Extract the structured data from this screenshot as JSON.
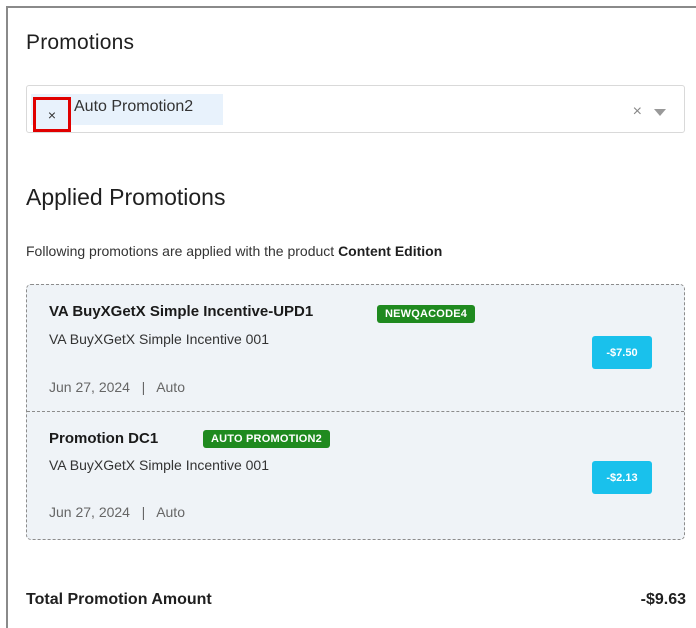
{
  "promotions": {
    "title": "Promotions",
    "selected_tag": "Auto Promotion2",
    "tag_remove_glyph": "×",
    "clear_glyph": "×"
  },
  "applied": {
    "title": "Applied Promotions",
    "description_prefix": "Following promotions are applied with the product",
    "product_name": "Content Edition",
    "items": [
      {
        "name": "VA BuyXGetX Simple Incentive-UPD1",
        "code": "NEWQACODE4",
        "description": "VA BuyXGetX Simple Incentive 001",
        "date": "Jun 27, 2024",
        "separator": "|",
        "type": "Auto",
        "amount": "-$7.50"
      },
      {
        "name": "Promotion DC1",
        "code": "AUTO PROMOTION2",
        "description": "VA BuyXGetX Simple Incentive 001",
        "date": "Jun 27, 2024",
        "separator": "|",
        "type": "Auto",
        "amount": "-$2.13"
      }
    ]
  },
  "total": {
    "label": "Total Promotion Amount",
    "value": "-$9.63"
  },
  "colors": {
    "code_badge": "#1f8a1f",
    "amount_badge": "#19c1ec",
    "highlight_border": "#e00000",
    "tag_background": "#e8f2fc",
    "promo_box_background": "#eff3f7"
  },
  "icons": {
    "tag_remove": "close-icon",
    "clear": "clear-icon",
    "dropdown": "chevron-down-icon"
  }
}
